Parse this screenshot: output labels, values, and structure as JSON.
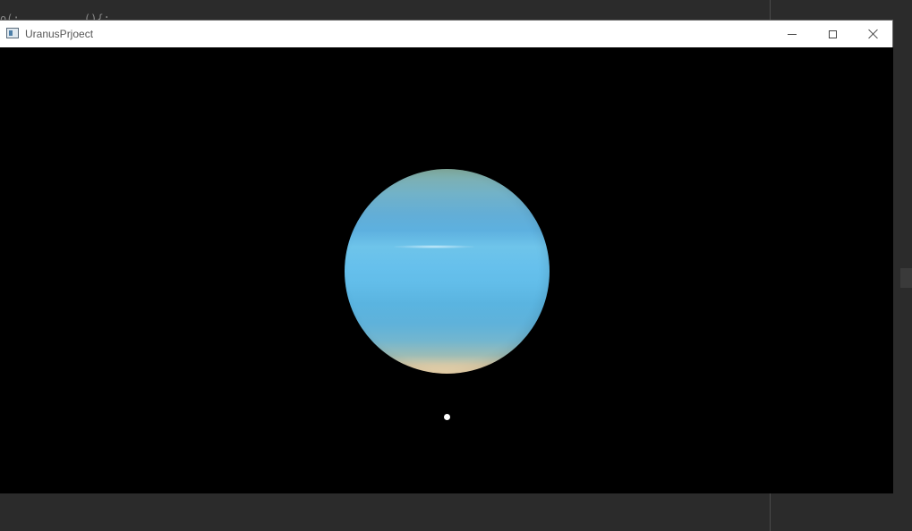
{
  "window": {
    "title": "UranusPrjoect"
  },
  "background": {
    "code_fragment": "o(:          (){;"
  },
  "scene": {
    "planet_icon": "uranus-planet",
    "moon_icon": "moon-dot",
    "background_color": "#000000"
  },
  "controls": {
    "minimize_icon": "minimize-icon",
    "maximize_icon": "maximize-icon",
    "close_icon": "close-icon"
  }
}
